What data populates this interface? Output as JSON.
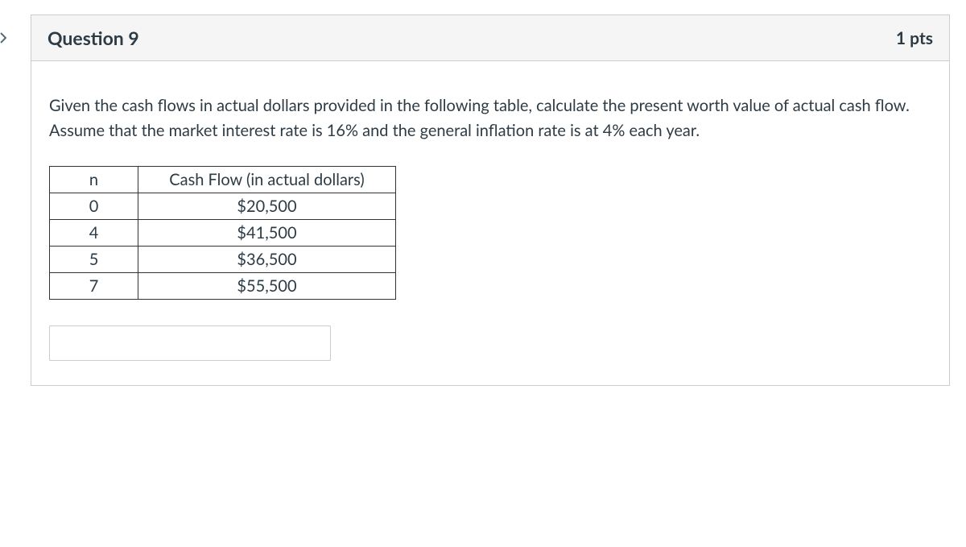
{
  "nav": {
    "prev_icon": "chevron-right"
  },
  "question": {
    "title": "Question 9",
    "points": "1 pts",
    "prompt": "Given the cash flows in actual dollars provided in the following table, calculate the present worth value of actual cash flow. Assume that the market interest rate is 16% and the general inflation rate is at 4% each year.",
    "table": {
      "headers": {
        "n": "n",
        "cash_flow": "Cash Flow (in actual dollars)"
      },
      "rows": [
        {
          "n": "0",
          "cash_flow": "$20,500"
        },
        {
          "n": "4",
          "cash_flow": "$41,500"
        },
        {
          "n": "5",
          "cash_flow": "$36,500"
        },
        {
          "n": "7",
          "cash_flow": "$55,500"
        }
      ]
    },
    "answer_value": ""
  }
}
